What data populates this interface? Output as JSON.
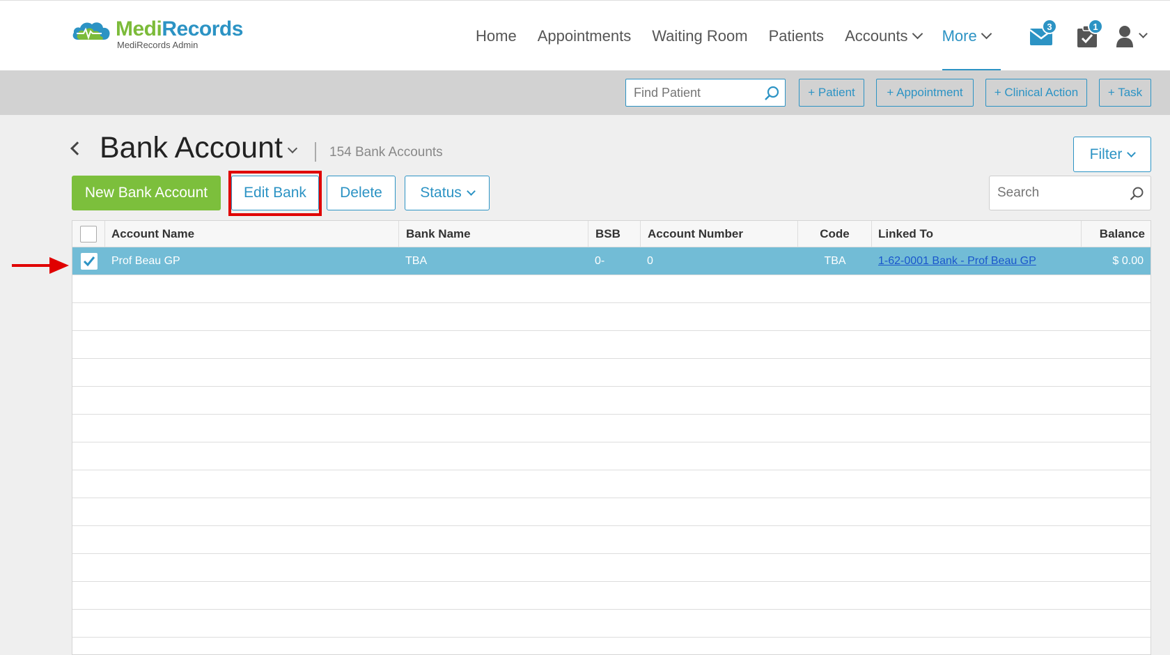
{
  "app": {
    "brand_medi": "Medi",
    "brand_records": "Records",
    "subtitle": "MediRecords Admin"
  },
  "nav": {
    "items": [
      {
        "label": "Home"
      },
      {
        "label": "Appointments"
      },
      {
        "label": "Waiting Room"
      },
      {
        "label": "Patients"
      },
      {
        "label": "Accounts"
      },
      {
        "label": "More"
      }
    ],
    "active": "More",
    "messages_badge": "3",
    "tasks_badge": "1"
  },
  "actionbar": {
    "find_placeholder": "Find Patient",
    "patient_label": "+ Patient",
    "appointment_label": "+ Appointment",
    "clinical_action_label": "+ Clinical Action",
    "task_label": "+ Task"
  },
  "page": {
    "title": "Bank Account",
    "count": "154 Bank Accounts",
    "filter_label": "Filter"
  },
  "toolbar": {
    "new_label": "New Bank Account",
    "edit_label": "Edit Bank",
    "delete_label": "Delete",
    "status_label": "Status",
    "search_placeholder": "Search"
  },
  "table": {
    "columns": [
      "Account Name",
      "Bank Name",
      "BSB",
      "Account Number",
      "Code",
      "Linked To",
      "Balance"
    ],
    "rows": [
      {
        "selected": true,
        "account_name": "Prof Beau GP",
        "bank_name": "TBA",
        "bsb": "0-",
        "account_number": "0",
        "code": "TBA",
        "linked_to": "1-62-0001 Bank - Prof Beau GP",
        "balance": "$ 0.00"
      }
    ]
  },
  "colors": {
    "brand_green": "#7cbb3a",
    "brand_blue": "#2c93c4",
    "selected_row": "#72bcd6",
    "highlight": "#e00000"
  }
}
